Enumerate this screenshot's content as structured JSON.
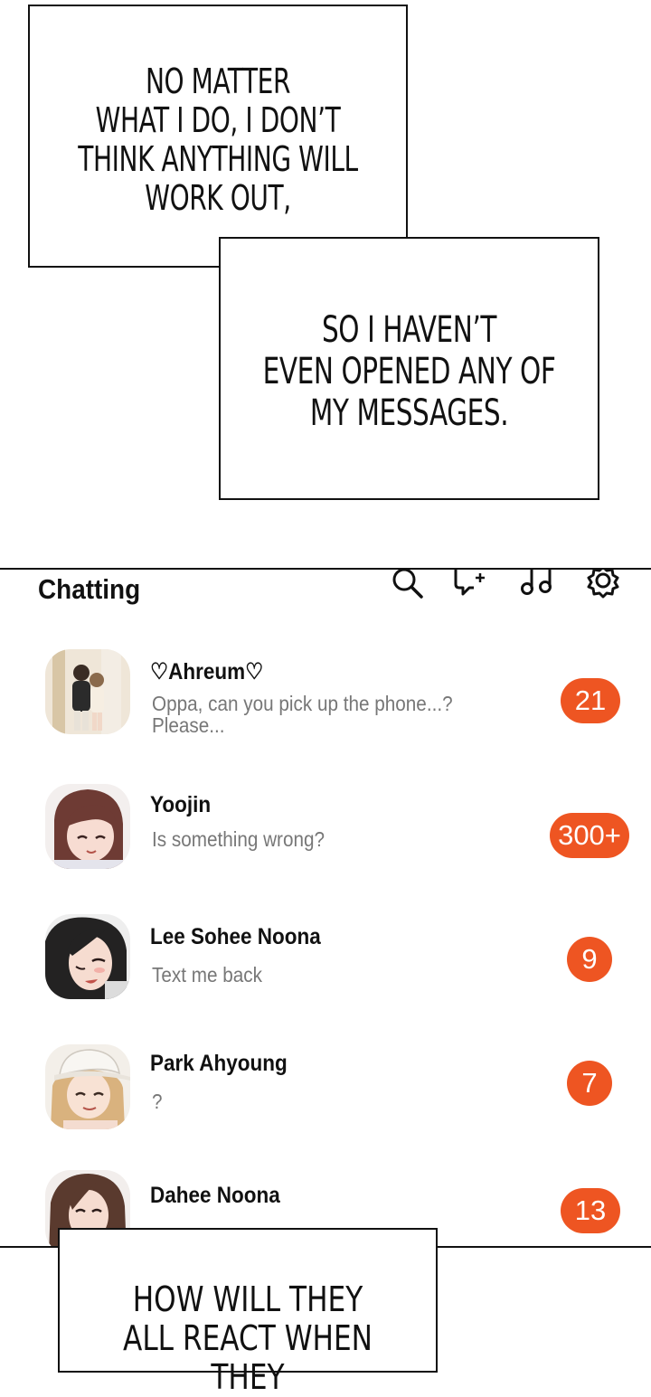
{
  "captions": {
    "top_left": "NO MATTER\nWHAT I DO, I DON’T\nTHINK ANYTHING WILL\nWORK OUT,",
    "top_right": "SO I HAVEN’T\nEVEN OPENED ANY OF\nMY MESSAGES.",
    "bottom": "HOW WILL THEY\nALL REACT WHEN THEY"
  },
  "app": {
    "title": "Chatting",
    "icons": [
      "search-icon",
      "new-chat-icon",
      "music-icon",
      "settings-icon"
    ],
    "accent": "#ee5522"
  },
  "chats": [
    {
      "name": "♡Ahreum♡",
      "preview": "Oppa, can you pick up the phone...?\nPlease...",
      "badge": "21"
    },
    {
      "name": "Yoojin",
      "preview": "Is something wrong?",
      "badge": "300+"
    },
    {
      "name": "Lee Sohee Noona",
      "preview": "Text me back",
      "badge": "9"
    },
    {
      "name": "Park Ahyoung",
      "preview": "?",
      "badge": "7"
    },
    {
      "name": "Dahee Noona",
      "preview": "",
      "badge": "13"
    }
  ]
}
